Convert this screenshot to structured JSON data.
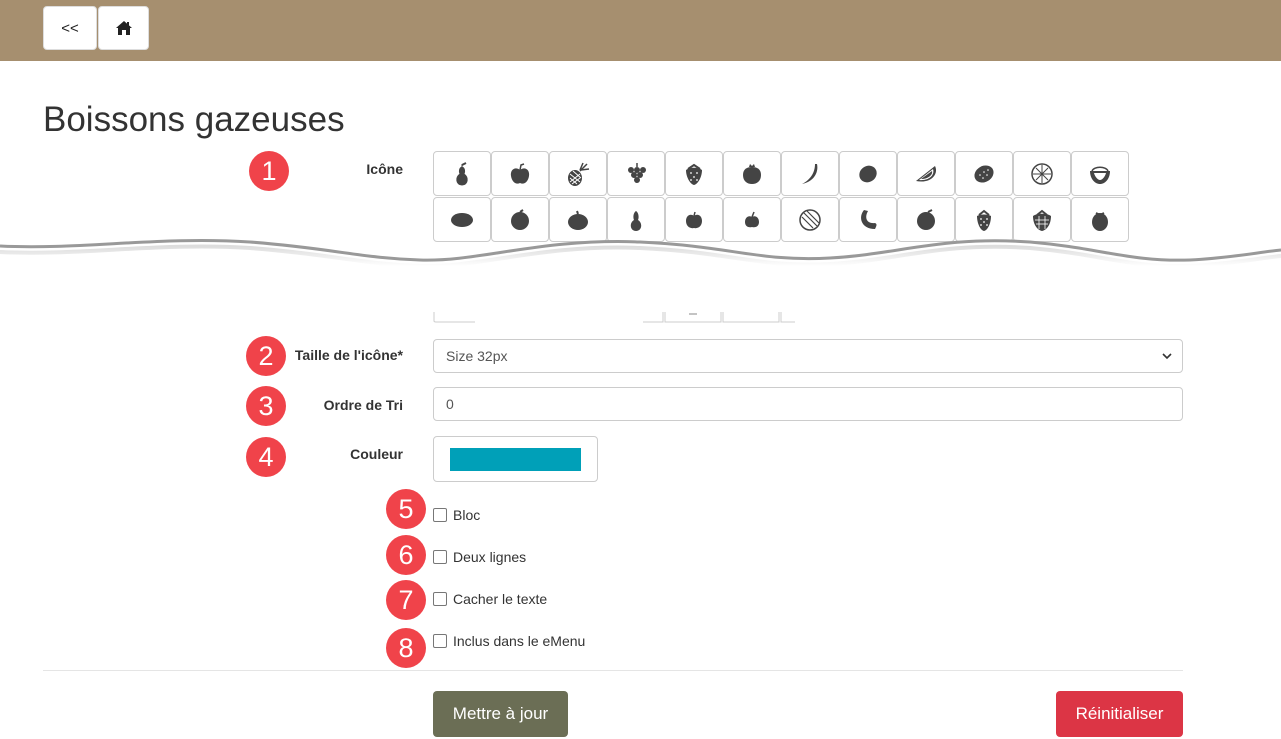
{
  "header": {
    "back_label": "<<",
    "home_icon": "home-icon"
  },
  "page": {
    "title": "Boissons gazeuses"
  },
  "badges": [
    "1",
    "2",
    "3",
    "4",
    "5",
    "6",
    "7",
    "8"
  ],
  "labels": {
    "icon": "Icône",
    "icon_size": "Taille de l'icône*",
    "sort_order": "Ordre de Tri",
    "color": "Couleur"
  },
  "icons": {
    "row1": [
      "pear-icon",
      "apple-icon",
      "pineapple-icon",
      "grapes-icon",
      "strawberry-icon",
      "pomegranate-icon",
      "banana-icon",
      "lemon-icon",
      "watermelon-slice-icon",
      "passion-fruit-icon",
      "orange-slice-icon",
      "fig-half-icon"
    ],
    "row2": [
      "lime-icon",
      "orange-icon",
      "tangerine-icon",
      "pear-icon",
      "apple-icon",
      "cherry-apple-icon",
      "melon-icon",
      "crescent-fruit-icon",
      "plum-icon",
      "strawberry-icon",
      "raspberry-icon",
      "berry-icon"
    ]
  },
  "icon_size": {
    "value": "Size 32px"
  },
  "sort_order": {
    "value": "0"
  },
  "color": {
    "value": "#00a0b8"
  },
  "checkboxes": {
    "bloc": "Bloc",
    "two_lines": "Deux lignes",
    "hide_text": "Cacher le texte",
    "in_emenu": "Inclus dans le eMenu"
  },
  "actions": {
    "update": "Mettre à jour",
    "reset": "Réinitialiser"
  },
  "theme": {
    "header": "#a68f6f",
    "badge": "#f0434a",
    "update_btn": "#6b6e55",
    "reset_btn": "#dc3545"
  }
}
